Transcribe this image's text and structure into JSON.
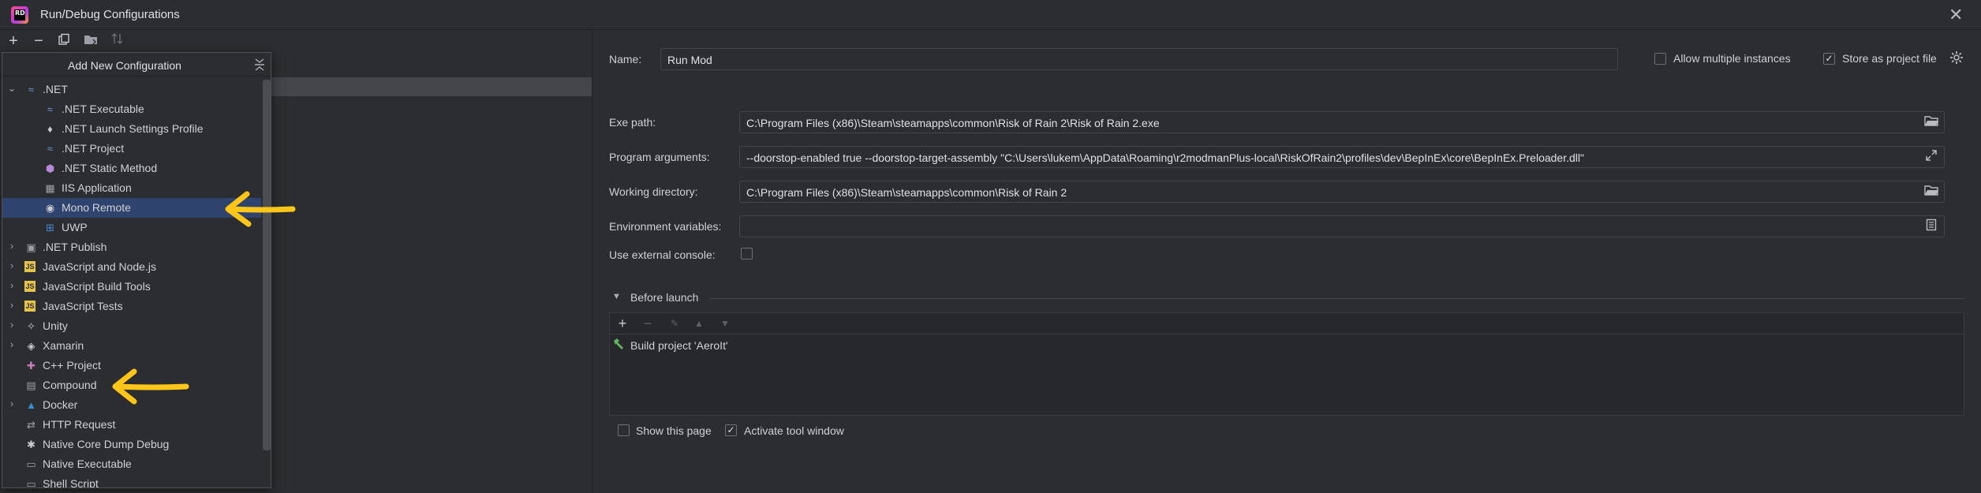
{
  "window": {
    "title": "Run/Debug Configurations",
    "app_icon_text": "RD"
  },
  "toolbar": {
    "add": "+",
    "remove": "−",
    "copy_icon": "copy-icon",
    "folder_icon": "folder-icon",
    "sort_icon": "sort-icon"
  },
  "popup": {
    "title": "Add New Configuration",
    "items": [
      {
        "label": ".NET",
        "level": 0,
        "expanded": true,
        "icon": "dotnet-icon",
        "selected": false
      },
      {
        "label": ".NET Executable",
        "level": 1,
        "icon": "dotnet-exe-icon",
        "selected": false
      },
      {
        "label": ".NET Launch Settings Profile",
        "level": 1,
        "icon": "launch-profile-icon",
        "selected": false
      },
      {
        "label": ".NET Project",
        "level": 1,
        "icon": "dotnet-project-icon",
        "selected": false
      },
      {
        "label": ".NET Static Method",
        "level": 1,
        "icon": "static-method-icon",
        "selected": false
      },
      {
        "label": "IIS Application",
        "level": 1,
        "icon": "iis-icon",
        "selected": false
      },
      {
        "label": "Mono Remote",
        "level": 1,
        "icon": "mono-icon",
        "selected": true
      },
      {
        "label": "UWP",
        "level": 1,
        "icon": "windows-icon",
        "selected": false
      },
      {
        "label": ".NET Publish",
        "level": 0,
        "expanded": false,
        "icon": "publish-icon",
        "selected": false
      },
      {
        "label": "JavaScript and Node.js",
        "level": 0,
        "expanded": false,
        "icon": "javascript-icon",
        "selected": false
      },
      {
        "label": "JavaScript Build Tools",
        "level": 0,
        "expanded": false,
        "icon": "js-build-icon",
        "selected": false
      },
      {
        "label": "JavaScript Tests",
        "level": 0,
        "expanded": false,
        "icon": "js-tests-icon",
        "selected": false
      },
      {
        "label": "Unity",
        "level": 0,
        "expanded": false,
        "icon": "unity-icon",
        "selected": false
      },
      {
        "label": "Xamarin",
        "level": 0,
        "expanded": false,
        "icon": "xamarin-icon",
        "selected": false
      },
      {
        "label": "C++ Project",
        "level": 0,
        "icon": "cpp-icon",
        "selected": false
      },
      {
        "label": "Compound",
        "level": 0,
        "icon": "compound-icon",
        "selected": false
      },
      {
        "label": "Docker",
        "level": 0,
        "expanded": false,
        "icon": "docker-icon",
        "selected": false
      },
      {
        "label": "HTTP Request",
        "level": 0,
        "icon": "http-icon",
        "selected": false
      },
      {
        "label": "Native Core Dump Debug",
        "level": 0,
        "icon": "core-dump-icon",
        "selected": false
      },
      {
        "label": "Native Executable",
        "level": 0,
        "icon": "native-exe-icon",
        "selected": false
      },
      {
        "label": "Shell Script",
        "level": 0,
        "icon": "shell-icon",
        "selected": false
      }
    ]
  },
  "form": {
    "name_label": "Name:",
    "name_value": "Run Mod",
    "allow_multiple_label": "Allow multiple instances",
    "allow_multiple_checked": false,
    "store_as_project_label": "Store as project file",
    "store_as_project_checked": true,
    "exe_path_label": "Exe path:",
    "exe_path_value": "C:\\Program Files (x86)\\Steam\\steamapps\\common\\Risk of Rain 2\\Risk of Rain 2.exe",
    "program_args_label": "Program arguments:",
    "program_args_value": "--doorstop-enabled true --doorstop-target-assembly \"C:\\Users\\lukem\\AppData\\Roaming\\r2modmanPlus-local\\RiskOfRain2\\profiles\\dev\\BepInEx\\core\\BepInEx.Preloader.dll\"",
    "working_dir_label": "Working directory:",
    "working_dir_value": "C:\\Program Files (x86)\\Steam\\steamapps\\common\\Risk of Rain 2",
    "env_vars_label": "Environment variables:",
    "env_vars_value": "",
    "external_console_label": "Use external console:",
    "external_console_checked": false
  },
  "before_launch": {
    "title": "Before launch",
    "tasks": [
      "Build project 'AeroIt'"
    ],
    "show_page_label": "Show this page",
    "show_page_checked": false,
    "activate_tool_label": "Activate tool window",
    "activate_tool_checked": true
  },
  "colors": {
    "selection": "#2e436e",
    "background": "#2b2d30",
    "annotation_arrow": "#ffc61a"
  }
}
